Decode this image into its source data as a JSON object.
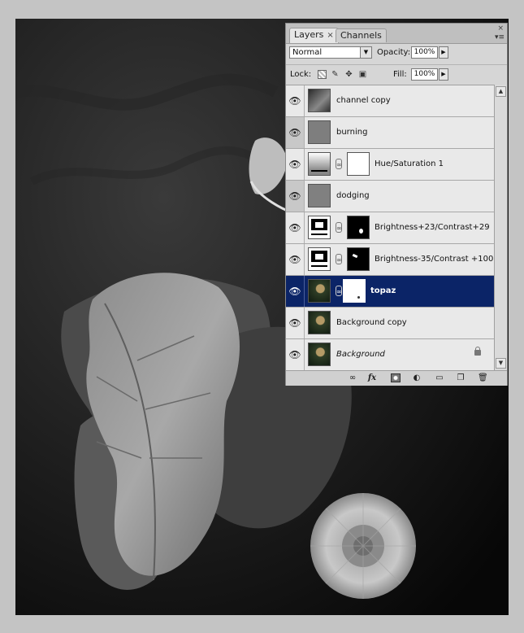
{
  "panel": {
    "tabs": [
      {
        "label": "Layers",
        "close": "×",
        "active": true
      },
      {
        "label": "Channels",
        "active": false
      }
    ],
    "close_glyph": "×",
    "menu_glyph": "▾≡",
    "blend_mode": "Normal",
    "opacity_label": "Opacity:",
    "opacity_value": "100%",
    "lock_label": "Lock:",
    "fill_label": "Fill:",
    "fill_value": "100%",
    "lock_icons": [
      "lock-transparent-icon",
      "lock-paint-icon",
      "lock-position-icon",
      "lock-all-icon"
    ],
    "layers": [
      {
        "name": "channel copy",
        "type": "image",
        "thumb": "photo-gray",
        "eye_dark": false,
        "selected": false
      },
      {
        "name": "burning",
        "type": "image",
        "thumb": "gray",
        "eye_dark": true,
        "selected": false
      },
      {
        "name": "Hue/Saturation 1",
        "type": "adjustment",
        "thumb": "huesat",
        "mask": "white",
        "eye_dark": false,
        "selected": false
      },
      {
        "name": "dodging",
        "type": "image",
        "thumb": "gray",
        "eye_dark": true,
        "selected": false
      },
      {
        "name": "Brightness+23/Contrast+29",
        "type": "adjustment",
        "thumb": "brightness",
        "mask": "black-dot",
        "eye_dark": false,
        "selected": false
      },
      {
        "name": "Brightness-35/Contrast +100",
        "type": "adjustment",
        "thumb": "brightness",
        "mask": "black-mark",
        "eye_dark": false,
        "selected": false
      },
      {
        "name": "topaz",
        "type": "image-mask",
        "thumb": "photo-color",
        "mask": "white",
        "eye_dark": false,
        "selected": true
      },
      {
        "name": "Background copy",
        "type": "image",
        "thumb": "photo-color",
        "eye_dark": false,
        "selected": false
      },
      {
        "name": "Background",
        "type": "image",
        "thumb": "photo-color",
        "eye_dark": false,
        "selected": false,
        "italic": true,
        "locked": true
      }
    ],
    "bottom_icons": [
      "link-layers-icon",
      "fx-icon",
      "add-mask-icon",
      "adjustment-layer-icon",
      "new-group-icon",
      "new-layer-icon",
      "trash-icon"
    ],
    "fx_label": "fx"
  },
  "colors": {
    "selected_row": "#0b2467",
    "canvas_bg": "#0d0d0d",
    "workspace": "#c4c4c4"
  }
}
